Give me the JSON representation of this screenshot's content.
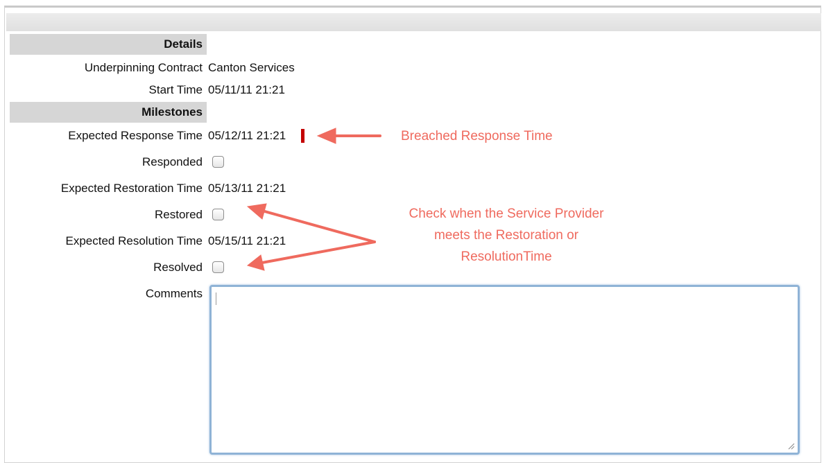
{
  "sections": {
    "details": {
      "title": "Details"
    },
    "milestones": {
      "title": "Milestones"
    }
  },
  "fields": {
    "underpinning_contract": {
      "label": "Underpinning Contract",
      "value": "Canton Services"
    },
    "start_time": {
      "label": "Start Time",
      "value": "05/11/11 21:21"
    },
    "expected_response_time": {
      "label": "Expected Response Time",
      "value": "05/12/11 21:21"
    },
    "responded": {
      "label": "Responded",
      "checked": false
    },
    "expected_restoration_time": {
      "label": "Expected Restoration Time",
      "value": "05/13/11 21:21"
    },
    "restored": {
      "label": "Restored",
      "checked": false
    },
    "expected_resolution_time": {
      "label": "Expected Resolution Time",
      "value": "05/15/11 21:21"
    },
    "resolved": {
      "label": "Resolved",
      "checked": false
    },
    "comments": {
      "label": "Comments",
      "value": ""
    }
  },
  "annotations": {
    "breached": "Breached Response Time",
    "check_line1": "Check when the Service Provider",
    "check_line2": "meets the Restoration  or",
    "check_line3": "ResolutionTime"
  },
  "colors": {
    "annotation": "#ef6a5e",
    "breach_marker": "#c40000",
    "section_header_bg": "#d6d6d6",
    "textarea_focus_border": "#8fb3d6"
  }
}
